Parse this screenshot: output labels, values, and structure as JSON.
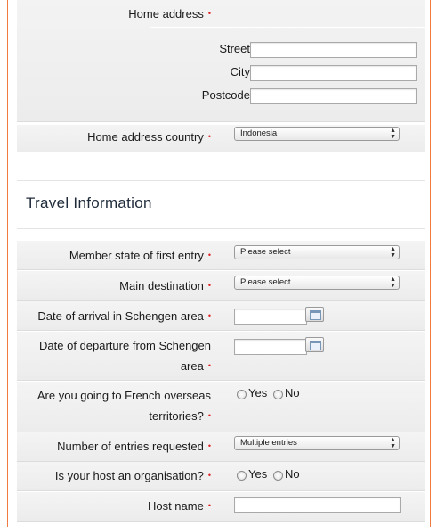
{
  "address": {
    "home_address_label": "Home address",
    "street_label": "Street",
    "street_value": "",
    "city_label": "City",
    "city_value": "",
    "postcode_label": "Postcode",
    "postcode_value": "",
    "country_label": "Home address country",
    "country_value": "Indonesia"
  },
  "travel": {
    "section_title": "Travel Information",
    "member_state_label": "Member state of first entry",
    "member_state_value": "Please select",
    "main_destination_label": "Main destination",
    "main_destination_value": "Please select",
    "arrival_label": "Date of arrival in Schengen area",
    "arrival_value": "",
    "departure_label_line1": "Date of departure from Schengen",
    "departure_label_line2": "area",
    "departure_value": "",
    "overseas_label_line1": "Are you going to French overseas",
    "overseas_label_line2": "territories?",
    "overseas_yes": "Yes",
    "overseas_no": "No",
    "entries_label": "Number of entries requested",
    "entries_value": "Multiple entries",
    "host_org_label": "Is your host an organisation?",
    "host_org_yes": "Yes",
    "host_org_no": "No",
    "host_name_label": "Host name",
    "host_name_value": ""
  },
  "required_marker": "•",
  "icons": {
    "calendar": "calendar-icon",
    "select_arrows": "updown-arrow-icon"
  },
  "colors": {
    "frame_border": "#f07b3e",
    "required": "#e02020"
  }
}
